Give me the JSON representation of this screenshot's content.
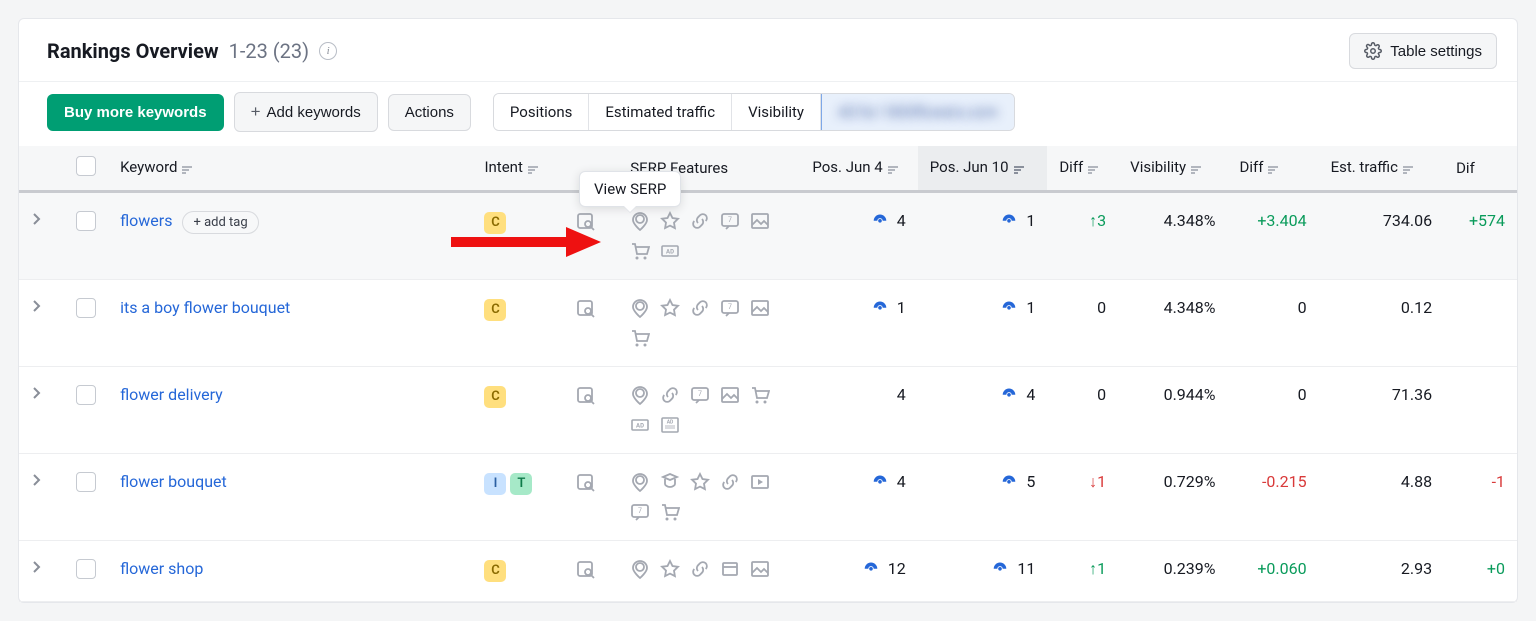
{
  "header": {
    "title": "Rankings Overview",
    "count_range": "1-23 (23)",
    "settings_label": "Table settings"
  },
  "toolbar": {
    "buy_label": "Buy more keywords",
    "add_label": "Add keywords",
    "actions_label": "Actions",
    "tabs": [
      "Positions",
      "Estimated traffic",
      "Visibility"
    ],
    "blurred_tab": "All for 1800flowers.com"
  },
  "tooltip": {
    "view_serp": "View SERP",
    "add_tag": "+ add tag"
  },
  "columns": {
    "keyword": "Keyword",
    "intent": "Intent",
    "serp_features": "SERP Features",
    "pos_prev": "Pos. Jun 4",
    "pos_cur": "Pos. Jun 10",
    "diff1": "Diff",
    "visibility": "Visibility",
    "diff2": "Diff",
    "traffic": "Est. traffic",
    "diff3": "Dif"
  },
  "intent_labels": {
    "C": "C",
    "I": "I",
    "T": "T"
  },
  "rows": [
    {
      "keyword": "flowers",
      "intents": [
        "C"
      ],
      "serp_icons": [
        "pin",
        "star",
        "link",
        "forum",
        "image",
        "cart",
        "ads"
      ],
      "pos_prev": "4",
      "pos_prev_link": true,
      "pos_cur": "1",
      "pos_cur_link": true,
      "diff1": "↑3",
      "diff1_dir": "up",
      "visibility": "4.348%",
      "diff2": "+3.404",
      "diff2_dir": "up",
      "traffic": "734.06",
      "diff3": "+574",
      "diff3_dir": "up",
      "highlight": true,
      "show_tag": true
    },
    {
      "keyword": "its a boy flower bouquet",
      "intents": [
        "C"
      ],
      "serp_icons": [
        "pin",
        "star",
        "link",
        "forum",
        "image",
        "cart"
      ],
      "pos_prev": "1",
      "pos_prev_link": true,
      "pos_cur": "1",
      "pos_cur_link": true,
      "diff1": "0",
      "diff1_dir": "none",
      "visibility": "4.348%",
      "diff2": "0",
      "diff2_dir": "none",
      "traffic": "0.12",
      "diff3": "",
      "diff3_dir": "none"
    },
    {
      "keyword": "flower delivery",
      "intents": [
        "C"
      ],
      "serp_icons": [
        "pin",
        "link",
        "forum",
        "image",
        "cart",
        "ads",
        "adsbox"
      ],
      "pos_prev": "4",
      "pos_prev_link": false,
      "pos_cur": "4",
      "pos_cur_link": true,
      "diff1": "0",
      "diff1_dir": "none",
      "visibility": "0.944%",
      "diff2": "0",
      "diff2_dir": "none",
      "traffic": "71.36",
      "diff3": "",
      "diff3_dir": "none"
    },
    {
      "keyword": "flower bouquet",
      "intents": [
        "I",
        "T"
      ],
      "serp_icons": [
        "pin",
        "knowledge",
        "star",
        "link",
        "video",
        "forum",
        "cart"
      ],
      "pos_prev": "4",
      "pos_prev_link": true,
      "pos_cur": "5",
      "pos_cur_link": true,
      "diff1": "↓1",
      "diff1_dir": "down",
      "visibility": "0.729%",
      "diff2": "-0.215",
      "diff2_dir": "down",
      "traffic": "4.88",
      "diff3": "-1",
      "diff3_dir": "down"
    },
    {
      "keyword": "flower shop",
      "intents": [
        "C"
      ],
      "serp_icons": [
        "pin",
        "star",
        "link",
        "box",
        "image"
      ],
      "pos_prev": "12",
      "pos_prev_link": true,
      "pos_cur": "11",
      "pos_cur_link": true,
      "diff1": "↑1",
      "diff1_dir": "up",
      "visibility": "0.239%",
      "diff2": "+0.060",
      "diff2_dir": "up",
      "traffic": "2.93",
      "diff3": "+0",
      "diff3_dir": "up"
    }
  ]
}
